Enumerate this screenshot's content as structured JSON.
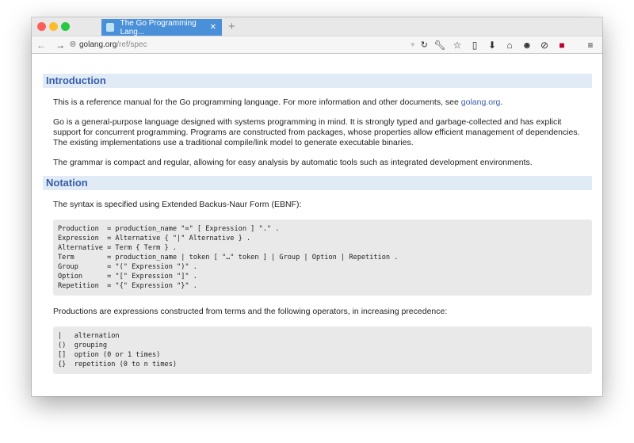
{
  "browser": {
    "tab_title": "The Go Programming Lang...",
    "url_host": "golang.org",
    "url_path": "/ref/spec",
    "toolbar_icons": [
      "wrench-icon",
      "star-icon",
      "clipboard-icon",
      "download-icon",
      "home-icon",
      "chat-icon",
      "shield-icon",
      "extension-icon",
      "menu-icon"
    ]
  },
  "sections": [
    {
      "title": "Introduction",
      "paragraphs": [
        {
          "text": "This is a reference manual for the Go programming language. For more information and other documents, see ",
          "link": "golang.org",
          "after": "."
        },
        {
          "text": "Go is a general-purpose language designed with systems programming in mind. It is strongly typed and garbage-collected and has explicit support for concurrent programming. Programs are constructed from packages, whose properties allow efficient management of dependencies. The existing implementations use a traditional compile/link model to generate executable binaries."
        },
        {
          "text": "The grammar is compact and regular, allowing for easy analysis by automatic tools such as integrated development environments."
        }
      ]
    },
    {
      "title": "Notation",
      "paragraphs": [
        {
          "text": "The syntax is specified using Extended Backus-Naur Form (EBNF):"
        },
        {
          "text": "Productions are expressions constructed from terms and the following operators, in increasing precedence:"
        }
      ],
      "code1": "Production  = production_name \"=\" [ Expression ] \".\" .\nExpression  = Alternative { \"|\" Alternative } .\nAlternative = Term { Term } .\nTerm        = production_name | token [ \"…\" token ] | Group | Option | Repetition .\nGroup       = \"(\" Expression \")\" .\nOption      = \"[\" Expression \"]\" .\nRepetition  = \"{\" Expression \"}\" .",
      "code2": "|   alternation\n()  grouping\n[]  option (0 or 1 times)\n{}  repetition (0 to n times)"
    }
  ]
}
